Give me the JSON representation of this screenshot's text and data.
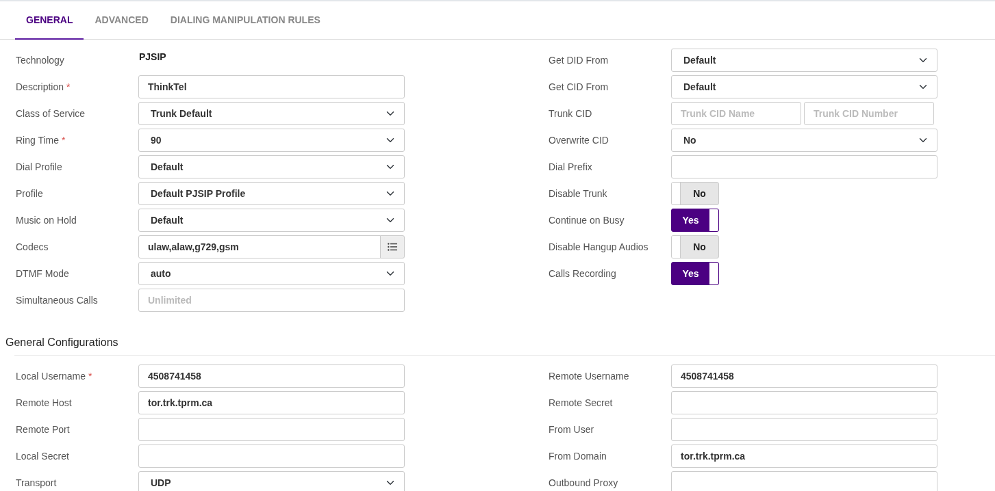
{
  "tabs": [
    {
      "label": "GENERAL",
      "selected": true
    },
    {
      "label": "ADVANCED",
      "selected": false
    },
    {
      "label": "DIALING MANIPULATION RULES",
      "selected": false
    }
  ],
  "general_left": [
    {
      "label": "Technology",
      "kind": "static",
      "value": "PJSIP"
    },
    {
      "label": "Description",
      "required_mark": "*",
      "kind": "text",
      "value": "ThinkTel"
    },
    {
      "label": "Class of Service",
      "kind": "select",
      "value": "Trunk Default"
    },
    {
      "label": "Ring Time",
      "required_mark": "*",
      "kind": "select",
      "value": "90"
    },
    {
      "label": "Dial Profile",
      "kind": "select",
      "value": "Default"
    },
    {
      "label": "Profile",
      "kind": "select",
      "value": "Default PJSIP Profile"
    },
    {
      "label": "Music on Hold",
      "kind": "select",
      "value": "Default"
    },
    {
      "label": "Codecs",
      "kind": "text_button",
      "value": "ulaw,alaw,g729,gsm"
    },
    {
      "label": "DTMF Mode",
      "kind": "select",
      "value": "auto"
    },
    {
      "label": "Simultaneous Calls",
      "kind": "text",
      "placeholder": "Unlimited"
    }
  ],
  "general_right": [
    {
      "label": "Get DID From",
      "kind": "select",
      "value": "Default"
    },
    {
      "label": "Get CID From",
      "kind": "select",
      "value": "Default"
    },
    {
      "label": "Trunk CID",
      "kind": "double",
      "placeholders": [
        "Trunk CID Name",
        "Trunk CID Number"
      ]
    },
    {
      "label": "Overwrite CID",
      "kind": "select",
      "value": "No"
    },
    {
      "label": "Dial Prefix",
      "kind": "text"
    },
    {
      "label": "Disable Trunk",
      "kind": "toggle",
      "on": false,
      "value": "No"
    },
    {
      "label": "Continue on Busy",
      "kind": "toggle",
      "on": true,
      "value": "Yes"
    },
    {
      "label": "Disable Hangup Audios",
      "kind": "toggle",
      "on": false,
      "value": "No"
    },
    {
      "label": "Calls Recording",
      "kind": "toggle",
      "on": true,
      "value": "Yes"
    }
  ],
  "section_title": "General Configurations",
  "config_left": [
    {
      "label": "Local Username",
      "required_mark": "*",
      "kind": "text",
      "value": "4508741458"
    },
    {
      "label": "Remote Host",
      "kind": "text",
      "value": "tor.trk.tprm.ca"
    },
    {
      "label": "Remote Port",
      "kind": "text"
    },
    {
      "label": "Local Secret",
      "kind": "text"
    },
    {
      "label": "Transport",
      "kind": "select",
      "value": "UDP"
    }
  ],
  "config_right": [
    {
      "label": "Remote Username",
      "kind": "text",
      "value": "4508741458"
    },
    {
      "label": "Remote Secret",
      "kind": "text"
    },
    {
      "label": "From User",
      "kind": "text"
    },
    {
      "label": "From Domain",
      "kind": "text",
      "value": "tor.trk.tprm.ca"
    },
    {
      "label": "Outbound Proxy",
      "kind": "text"
    }
  ]
}
